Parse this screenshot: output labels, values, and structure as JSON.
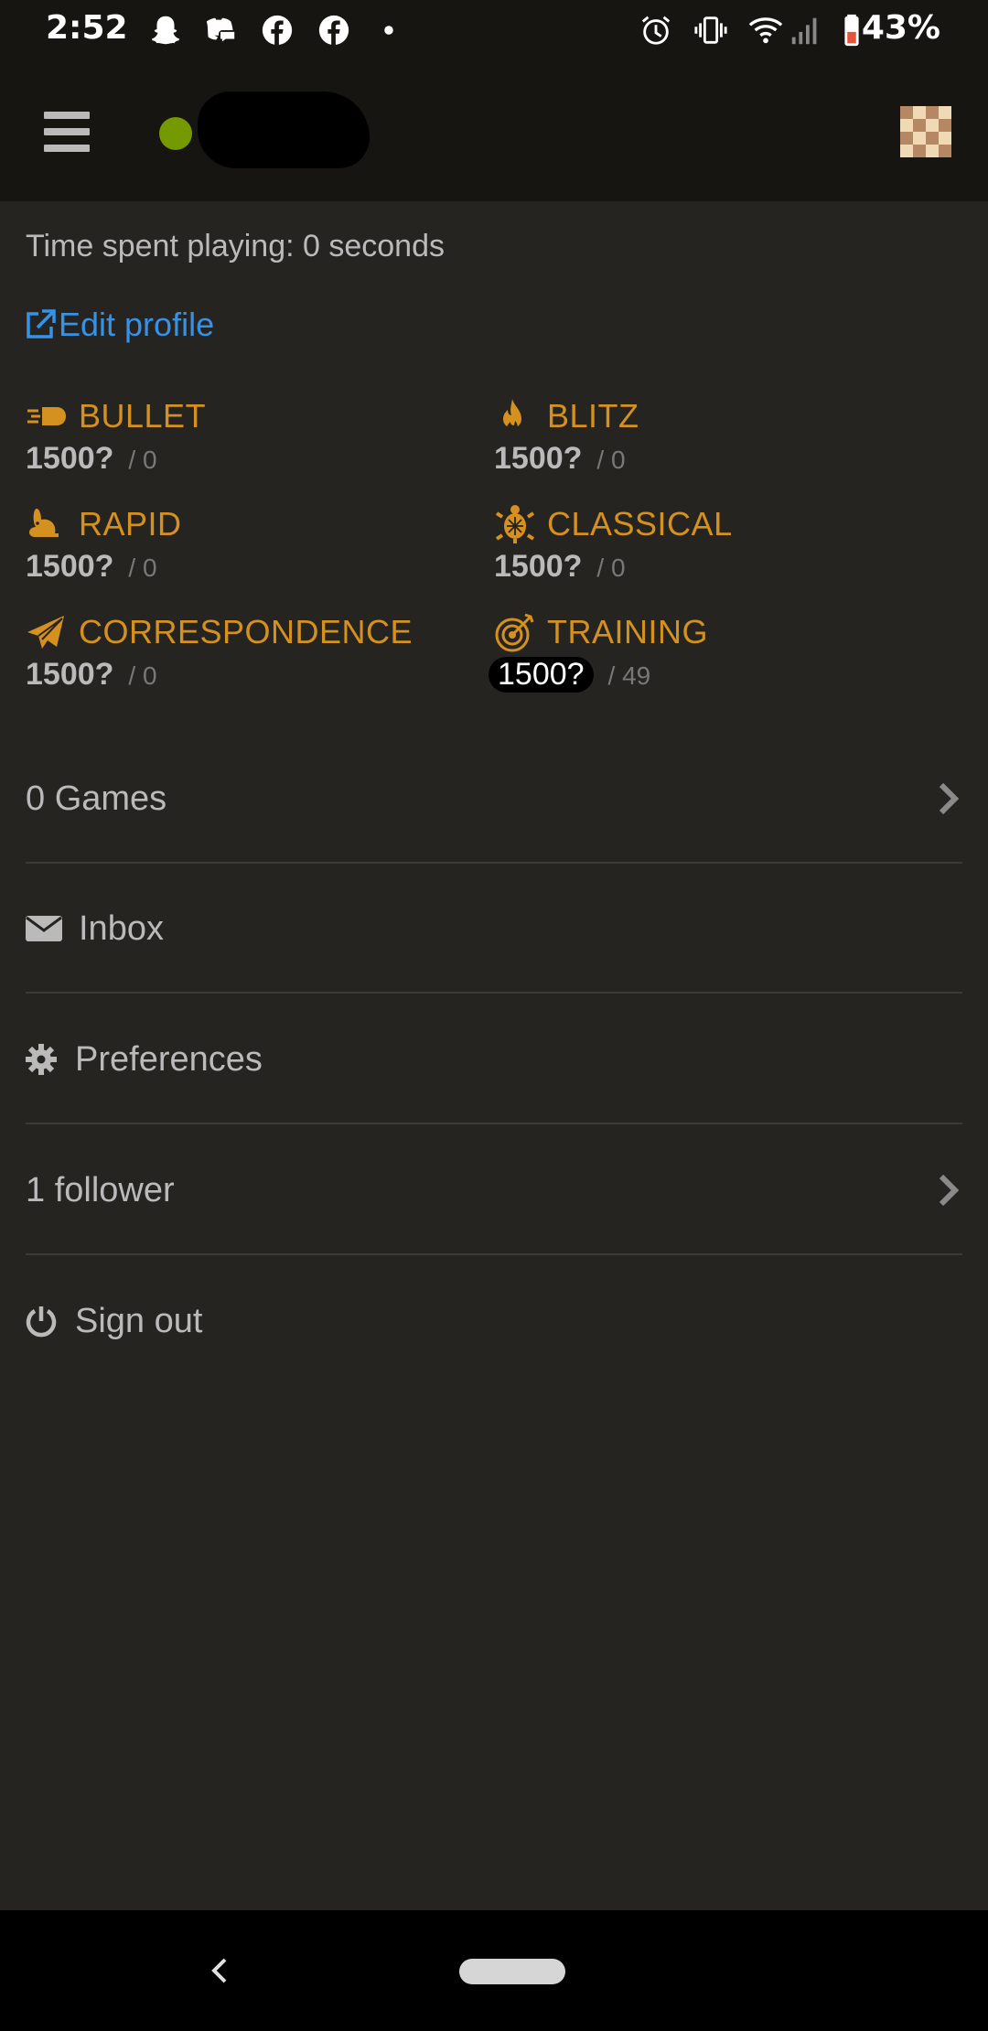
{
  "status_bar": {
    "time": "2:52",
    "battery": "43%",
    "icons": [
      "snapchat-icon",
      "discord-icon",
      "facebook-icon",
      "facebook-icon",
      "dot-icon",
      "alarm-icon",
      "vibrate-icon",
      "wifi-icon",
      "signal-icon",
      "battery-icon"
    ]
  },
  "header": {
    "online_color": "#759900"
  },
  "profile": {
    "time_spent": "Time spent playing: 0 seconds",
    "edit_profile": "Edit profile"
  },
  "perfs": [
    {
      "name": "BULLET",
      "rating": "1500?",
      "games": "/ 0",
      "icon": "bullet-icon"
    },
    {
      "name": "BLITZ",
      "rating": "1500?",
      "games": "/ 0",
      "icon": "flame-icon"
    },
    {
      "name": "RAPID",
      "rating": "1500?",
      "games": "/ 0",
      "icon": "rabbit-icon"
    },
    {
      "name": "CLASSICAL",
      "rating": "1500?",
      "games": "/ 0",
      "icon": "turtle-icon"
    },
    {
      "name": "CORRESPONDENCE",
      "rating": "1500?",
      "games": "/ 0",
      "icon": "paper-plane-icon"
    },
    {
      "name": "TRAINING",
      "rating": "1500?",
      "games": "/ 49",
      "icon": "target-icon"
    }
  ],
  "menu": {
    "games": "0 Games",
    "inbox": "Inbox",
    "preferences": "Preferences",
    "followers": "1 follower",
    "sign_out": "Sign out"
  },
  "colors": {
    "accent": "#d59120",
    "link": "#3692e7",
    "background": "#262421",
    "header": "#161512"
  }
}
